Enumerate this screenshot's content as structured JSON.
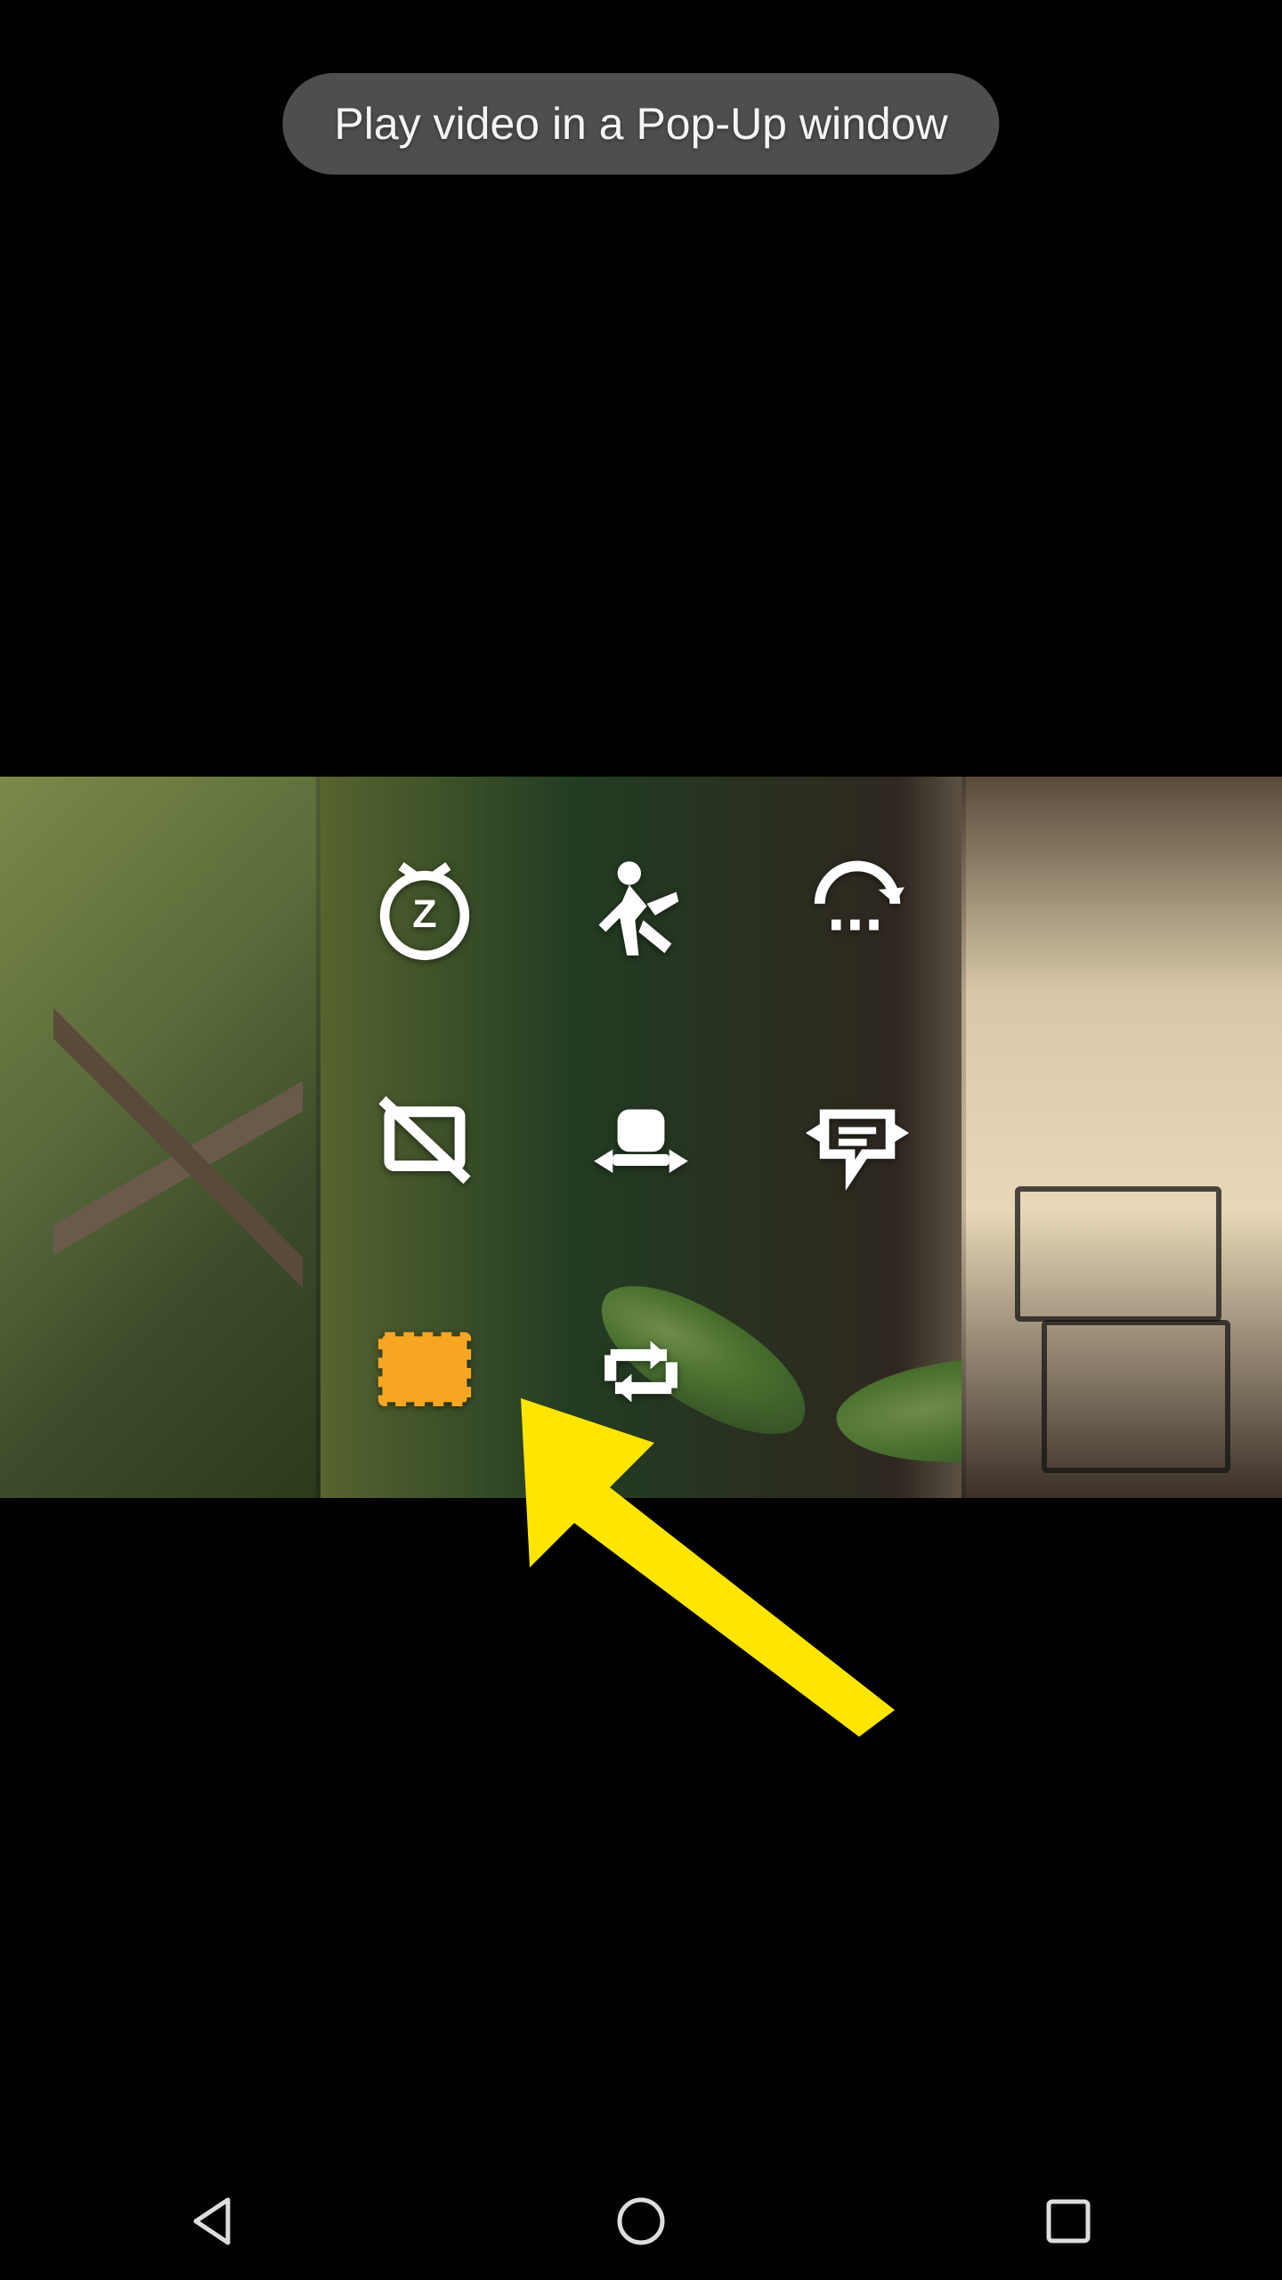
{
  "toast": {
    "text": "Play video in a Pop-Up window"
  },
  "controls": {
    "grid": [
      {
        "name": "sleep-timer-icon"
      },
      {
        "name": "playback-speed-icon"
      },
      {
        "name": "rotate-icon"
      },
      {
        "name": "aspect-ratio-off-icon"
      },
      {
        "name": "screen-stretch-icon"
      },
      {
        "name": "subtitle-sync-icon"
      },
      {
        "name": "popup-play-icon"
      },
      {
        "name": "repeat-icon"
      }
    ],
    "selected_index": 6
  },
  "annotation": {
    "target": "popup-play-icon",
    "color": "#ffe600"
  },
  "navbar": {
    "back": "back",
    "home": "home",
    "recent": "recent"
  }
}
